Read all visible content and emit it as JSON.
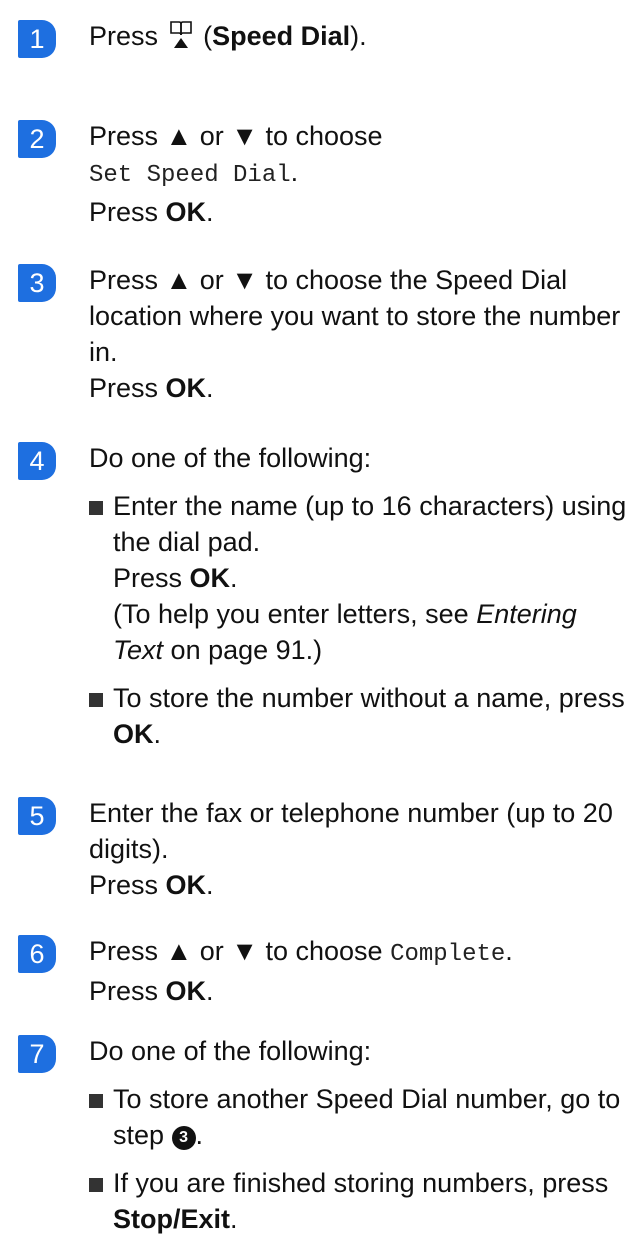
{
  "accent_color": "#1e6fe0",
  "steps": [
    {
      "number": "1",
      "press": "Press",
      "icon": "phone-book-icon",
      "paren_open": "(",
      "button": "Speed Dial",
      "tail": ")."
    },
    {
      "number": "2",
      "line1": "Press ▲ or ▼ to choose",
      "menu": "Set Speed Dial",
      "menu_tail": ".",
      "press": "Press ",
      "ok": "OK",
      "dot": "."
    },
    {
      "number": "3",
      "text": "Press ▲ or ▼ to choose the Speed Dial location where you want to store the number in.",
      "press": "Press ",
      "ok": "OK",
      "dot": "."
    },
    {
      "number": "4",
      "intro": "Do one of the following:",
      "bullet1_text": "Enter the name (up to 16 characters) using the dial pad.",
      "bullet1_press": "Press ",
      "bullet1_ok": "OK",
      "bullet1_dot": ".",
      "note_open": "(To help you enter letters, see ",
      "note_link": "Entering Text",
      "note_close": " on page 91.)",
      "bullet2_text": "To store the number without a name, press ",
      "bullet2_ok": "OK",
      "bullet2_dot": "."
    },
    {
      "number": "5",
      "text": "Enter the fax or telephone number (up to 20 digits).",
      "press": "Press ",
      "ok": "OK",
      "dot": "."
    },
    {
      "number": "6",
      "prefix": "Press ▲ or ▼ to choose ",
      "menu": "Complete",
      "menu_tail": ".",
      "press": "Press ",
      "ok": "OK",
      "dot": "."
    },
    {
      "number": "7",
      "intro": "Do one of the following:",
      "bullet1_text": "To store another Speed Dial number, go to step ",
      "step_ref": "3",
      "bullet1_dot": ".",
      "bullet2_text": "If you are finished storing numbers, press ",
      "bullet2_button": "Stop/Exit",
      "bullet2_dot": "."
    }
  ]
}
